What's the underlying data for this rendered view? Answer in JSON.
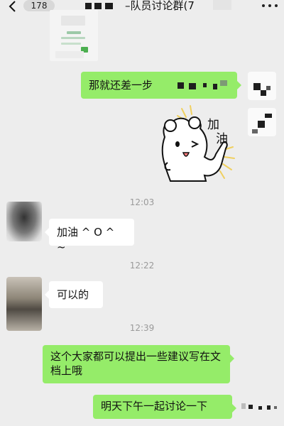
{
  "header": {
    "unread_count": "178",
    "title": "–队员讨论群(7",
    "colors": {
      "background": "#ededed",
      "text": "#111111"
    }
  },
  "chat": {
    "messages": [
      {
        "sender": "me",
        "type": "text",
        "text": "那就还差一步"
      },
      {
        "sender": "me",
        "type": "sticker",
        "sticker_text": "加油"
      },
      {
        "type": "time",
        "text": "12:03"
      },
      {
        "sender": "other",
        "type": "text",
        "text": "加油 ^ O ^ ~"
      },
      {
        "type": "time",
        "text": "12:22"
      },
      {
        "sender": "other",
        "type": "text",
        "text": "可以的"
      },
      {
        "type": "time",
        "text": "12:39"
      },
      {
        "sender": "me",
        "type": "text",
        "text": "这个大家都可以提出一些建议写在文档上哦"
      },
      {
        "sender": "me",
        "type": "text",
        "text": "明天下午一起讨论一下"
      }
    ],
    "colors": {
      "my_bubble": "#95ec69",
      "other_bubble": "#ffffff",
      "time": "#9a9a9a"
    }
  },
  "icons": [
    "back-icon",
    "more-icon"
  ]
}
